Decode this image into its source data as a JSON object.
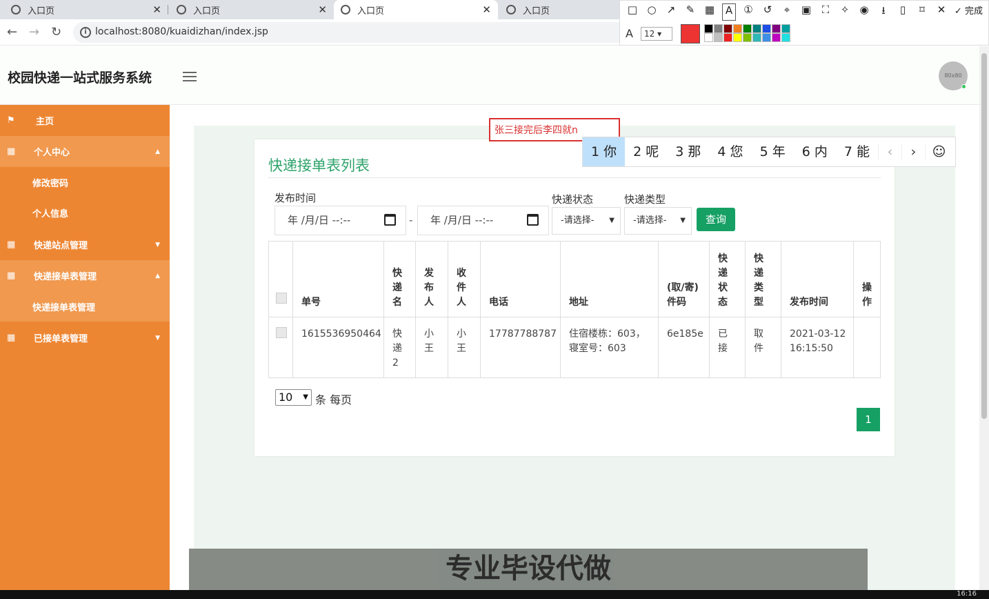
{
  "browser": {
    "tabs": [
      {
        "label": "入口页"
      },
      {
        "label": "入口页"
      },
      {
        "label": "入口页"
      },
      {
        "label": "入口页"
      }
    ],
    "url": "localhost:8080/kuaidizhan/index.jsp"
  },
  "screenshot_tool": {
    "done_label": "完成",
    "font_size": "12",
    "current_color": "#ee3333",
    "palette": [
      "#000000",
      "#808080",
      "#800000",
      "#f07e1e",
      "#008000",
      "#008080",
      "#1e4ee6",
      "#800080",
      "#00a0a0",
      "#ffffff",
      "#c0c0c0",
      "#ee2222",
      "#ffff00",
      "#80c000",
      "#2eb8b8",
      "#3e8ee6",
      "#c000c0",
      "#20e0e0"
    ]
  },
  "header": {
    "brand": "校园快递一站式服务系统",
    "avatar_text": "80x80"
  },
  "sidebar": {
    "items": [
      {
        "label": "主页"
      },
      {
        "label": "个人中心"
      },
      {
        "label": "修改密码"
      },
      {
        "label": "个人信息"
      },
      {
        "label": "快递站点管理"
      },
      {
        "label": "快递接单表管理"
      },
      {
        "label": "快递接单表管理"
      },
      {
        "label": "已接单表管理"
      }
    ]
  },
  "card": {
    "title": "快递接单表列表",
    "filter": {
      "publish_time_label": "发布时间",
      "date_from_placeholder": "年 /月/日 --:--",
      "date_to_placeholder": "年 /月/日 --:--",
      "dash": "-",
      "status_label": "快递状态",
      "status_value": "-请选择-",
      "type_label": "快递类型",
      "type_value": "-请选择-",
      "query_label": "查询"
    },
    "table": {
      "headers": [
        "单号",
        "快递名",
        "发布人",
        "收件人",
        "电话",
        "地址",
        "(取/寄)件码",
        "快递状态",
        "快递类型",
        "发布时间",
        "操作"
      ],
      "rows": [
        {
          "order_no": "1615536950464",
          "express_name": "快递2",
          "publisher": "小王",
          "receiver": "小王",
          "phone": "17787788787",
          "address": "住宿楼栋：603，寝室号：603",
          "code": "6e185e",
          "status": "已接",
          "type": "取件",
          "publish_time": "2021-03-12 16:15:50",
          "action": ""
        }
      ]
    },
    "pager": {
      "page_size": "10",
      "page_size_label": "条 每页",
      "current_page": "1"
    }
  },
  "ime": {
    "composition": "张三接完后李四就n",
    "candidates": [
      "1 你",
      "2 呢",
      "3 那",
      "4 您",
      "5 年",
      "6 内",
      "7 能"
    ]
  },
  "banner": {
    "text": "专业毕设代做"
  },
  "taskbar": {
    "clock": "16:16"
  }
}
